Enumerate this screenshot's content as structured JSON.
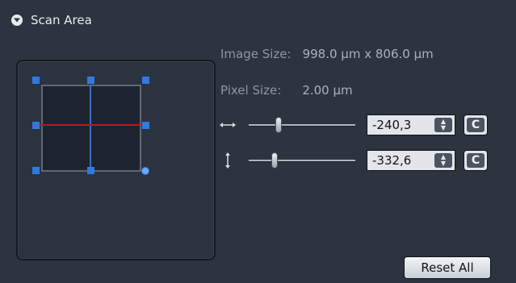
{
  "header": {
    "title": "Scan Area",
    "toggle_icon": "chevron-down-circle-icon"
  },
  "info": {
    "image_size_label": "Image Size:",
    "image_size_value": "998.0 µm x 806.0 µm",
    "pixel_size_label": "Pixel Size:",
    "pixel_size_value": "2.00 µm"
  },
  "offset_x": {
    "icon": "horizontal-arrow-icon",
    "value": "-240,3",
    "reset_label": "C"
  },
  "offset_y": {
    "icon": "vertical-arrow-icon",
    "value": "-332,6",
    "reset_label": "C"
  },
  "reset_all_label": "Reset All",
  "colors": {
    "panel_bg": "#2d3440",
    "handle_blue": "#2f7ae0",
    "crosshair_red": "#c0141e",
    "crosshair_blue": "#3b6ec0",
    "scan_field": "#1d2430"
  }
}
